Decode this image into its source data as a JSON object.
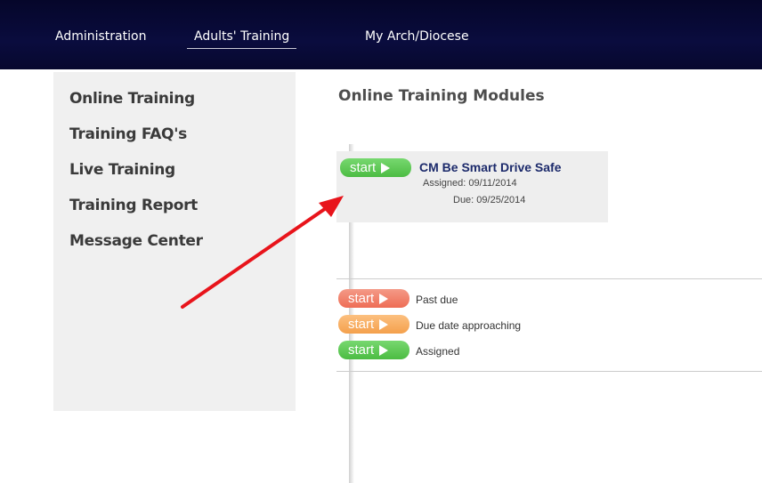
{
  "topnav": {
    "items": [
      {
        "label": "Administration"
      },
      {
        "label": "Adults' Training"
      },
      {
        "label": "My Arch/Diocese"
      }
    ]
  },
  "sidebar": {
    "links": [
      {
        "label": "Online Training"
      },
      {
        "label": "Training FAQ's"
      },
      {
        "label": "Live Training"
      },
      {
        "label": "Training Report"
      },
      {
        "label": "Message Center"
      }
    ]
  },
  "main": {
    "title": "Online Training Modules",
    "module": {
      "start_label": "start",
      "title": "CM Be Smart Drive Safe",
      "assigned": "Assigned: 09/11/2014",
      "due": "Due: 09/25/2014"
    },
    "legend": [
      {
        "start_label": "start",
        "text": "Past due",
        "color": "#ee6d55"
      },
      {
        "start_label": "start",
        "text": "Due date approaching",
        "color": "#f4a04c"
      },
      {
        "start_label": "start",
        "text": "Assigned",
        "color": "#4cbc43"
      }
    ]
  },
  "annotation": {
    "arrow_color": "#e8141b"
  }
}
